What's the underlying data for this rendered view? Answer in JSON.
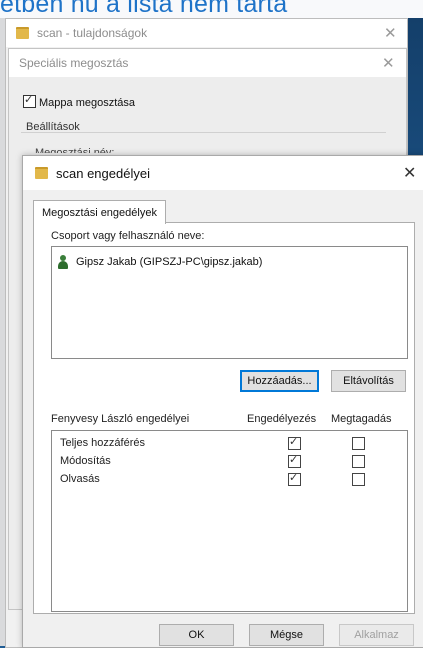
{
  "background_text": "etben nu a lista nem tarta",
  "win1": {
    "title": "scan - tulajdonságok",
    "close": "✕"
  },
  "win2": {
    "title": "Speciális megosztás",
    "close": "✕",
    "share_checkbox": {
      "label": "Mappa megosztása",
      "checked": true
    },
    "settings_legend": "Beállítások",
    "partial_label": "Megosztási név:"
  },
  "dialog": {
    "title": "scan engedélyei",
    "close": "✕",
    "tab": "Megosztási engedélyek",
    "group_label": "Csoport vagy felhasználó neve:",
    "users": [
      {
        "name": "Gipsz Jakab (GIPSZJ-PC\\gipsz.jakab)"
      }
    ],
    "add_button": "Hozzáadás...",
    "remove_button": "Eltávolítás",
    "perm_header": "Fenyvesy László engedélyei",
    "allow_header": "Engedélyezés",
    "deny_header": "Megtagadás",
    "permissions": [
      {
        "name": "Teljes hozzáférés",
        "allow": true,
        "deny": false
      },
      {
        "name": "Módosítás",
        "allow": true,
        "deny": false
      },
      {
        "name": "Olvasás",
        "allow": true,
        "deny": false
      }
    ],
    "ok_button": "OK",
    "cancel_button": "Mégse",
    "apply_button": "Alkalmaz"
  }
}
